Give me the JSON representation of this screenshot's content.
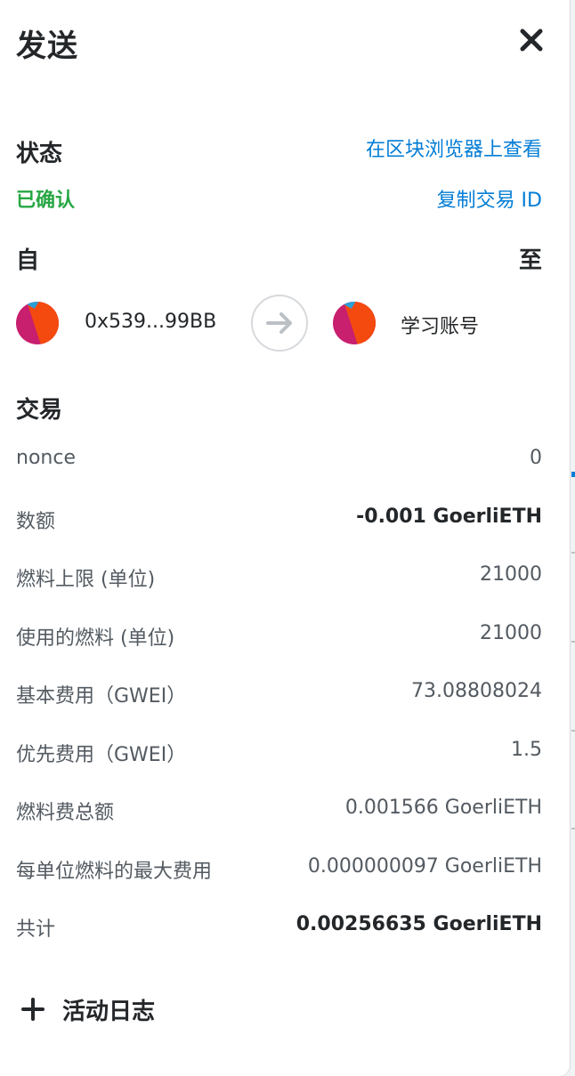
{
  "header": {
    "title": "发送",
    "close_icon": "close-icon"
  },
  "status": {
    "label": "状态",
    "value": "已确认",
    "value_color": "#28a745",
    "explorer_link": "在区块浏览器上查看",
    "copy_link": "复制交易 ID",
    "link_color": "#037dd6"
  },
  "parties": {
    "from_label": "自",
    "to_label": "至",
    "from_address": "0x539...99BB",
    "to_name": "学习账号",
    "arrow_icon": "arrow-right-icon"
  },
  "transaction": {
    "title": "交易",
    "rows": [
      {
        "key": "nonce",
        "value": "0"
      },
      {
        "key": "数额",
        "value": "-0.001 GoerliETH"
      },
      {
        "key": "燃料上限 (单位)",
        "value": "21000"
      },
      {
        "key": "使用的燃料 (单位)",
        "value": "21000"
      },
      {
        "key": "基本费用（GWEI）",
        "value": "73.08808024"
      },
      {
        "key": "优先费用（GWEI）",
        "value": "1.5"
      },
      {
        "key": "燃料费总额",
        "value": "0.001566 GoerliETH"
      },
      {
        "key": "每单位燃料的最大费用",
        "value": "0.000000097 GoerliETH"
      },
      {
        "key": "共计",
        "value": "0.00256635 GoerliETH"
      }
    ]
  },
  "activity": {
    "label": "活动日志",
    "icon": "plus-icon"
  }
}
